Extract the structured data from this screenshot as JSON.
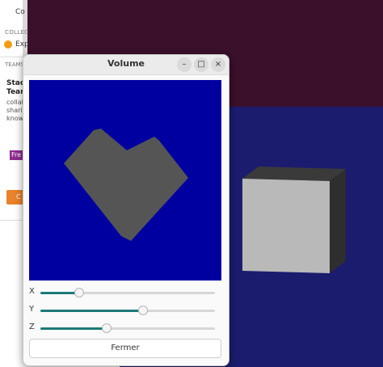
{
  "window": {
    "title": "Volume"
  },
  "titlebar_buttons": {
    "minimize": "–",
    "maximize": "□",
    "close": "×"
  },
  "sliders": [
    {
      "label": "X",
      "value": 0.22
    },
    {
      "label": "Y",
      "value": 0.59
    },
    {
      "label": "Z",
      "value": 0.38
    }
  ],
  "close_button": {
    "label": "Fermer"
  },
  "background_app": {
    "title_fragment": "Co",
    "collections_header": "COLLEC",
    "explore_item": "Exp",
    "teams_header": "TEAMS",
    "team_title_line1": "Stac",
    "team_title_line2": "Team",
    "team_desc": [
      "collab",
      "sharin",
      "know"
    ],
    "badge": "Fre",
    "button_fragment": "C"
  },
  "colors": {
    "viewport_bg": "#0000a0",
    "shape": "#555555",
    "slider_fill": "#1d7a78",
    "maroon_bg": "#3b102b",
    "navy_bg": "#1b1c6e"
  }
}
